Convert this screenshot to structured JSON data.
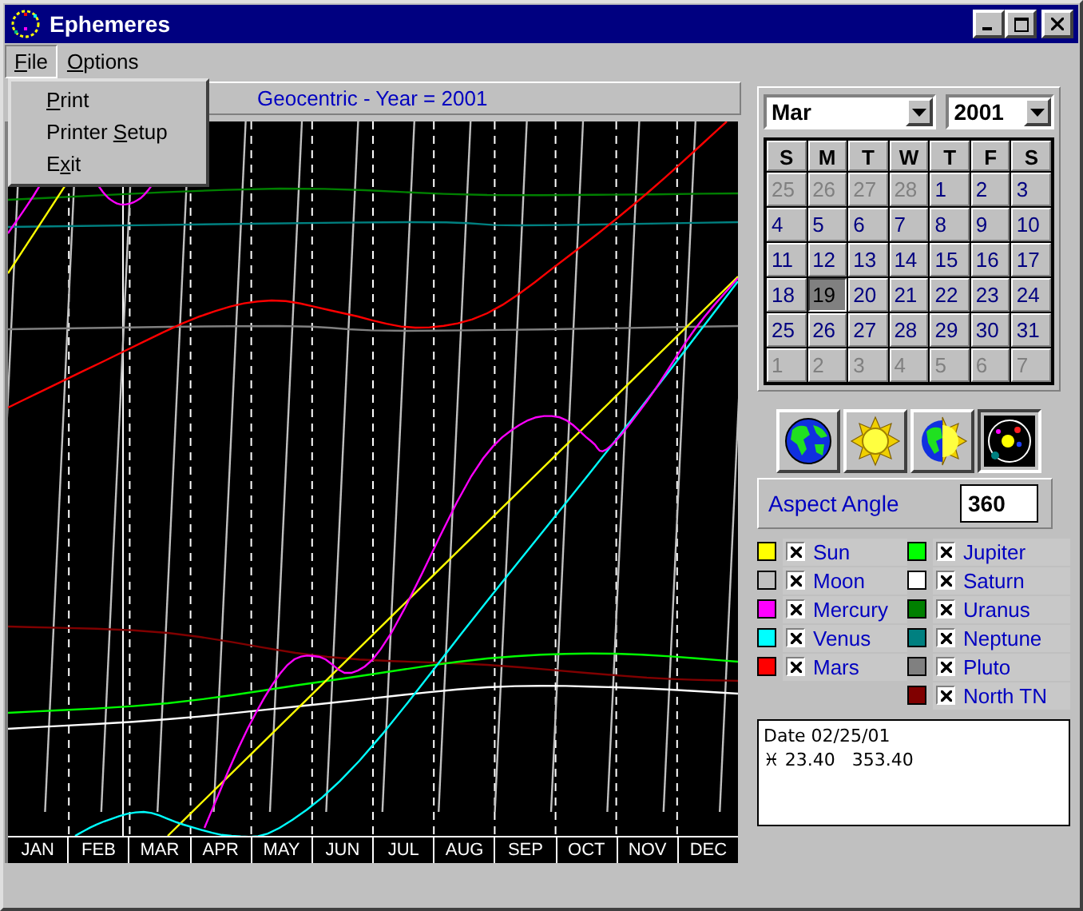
{
  "window": {
    "title": "Ephemeres"
  },
  "menu": [
    {
      "key": "F",
      "post": "ile",
      "open": true
    },
    {
      "key": "O",
      "post": "ptions",
      "open": false
    }
  ],
  "file_menu": [
    {
      "key": "P",
      "post": "rint"
    },
    {
      "pre": "Printer ",
      "key": "S",
      "post": "etup"
    },
    {
      "pre": "E",
      "key": "x",
      "post": "it"
    }
  ],
  "chart_header": "Geocentric - Year = 2001",
  "months": [
    "JAN",
    "FEB",
    "MAR",
    "APR",
    "MAY",
    "JUN",
    "JUL",
    "AUG",
    "SEP",
    "OCT",
    "NOV",
    "DEC"
  ],
  "calendar": {
    "month": "Mar",
    "year": "2001",
    "weekdays": [
      "S",
      "M",
      "T",
      "W",
      "T",
      "F",
      "S"
    ],
    "days": [
      {
        "day": "25",
        "current": false,
        "selected": false
      },
      {
        "day": "26",
        "current": false,
        "selected": false
      },
      {
        "day": "27",
        "current": false,
        "selected": false
      },
      {
        "day": "28",
        "current": false,
        "selected": false
      },
      {
        "day": "1",
        "current": true,
        "selected": false
      },
      {
        "day": "2",
        "current": true,
        "selected": false
      },
      {
        "day": "3",
        "current": true,
        "selected": false
      },
      {
        "day": "4",
        "current": true,
        "selected": false
      },
      {
        "day": "5",
        "current": true,
        "selected": false
      },
      {
        "day": "6",
        "current": true,
        "selected": false
      },
      {
        "day": "7",
        "current": true,
        "selected": false
      },
      {
        "day": "8",
        "current": true,
        "selected": false
      },
      {
        "day": "9",
        "current": true,
        "selected": false
      },
      {
        "day": "10",
        "current": true,
        "selected": false
      },
      {
        "day": "11",
        "current": true,
        "selected": false
      },
      {
        "day": "12",
        "current": true,
        "selected": false
      },
      {
        "day": "13",
        "current": true,
        "selected": false
      },
      {
        "day": "14",
        "current": true,
        "selected": false
      },
      {
        "day": "15",
        "current": true,
        "selected": false
      },
      {
        "day": "16",
        "current": true,
        "selected": false
      },
      {
        "day": "17",
        "current": true,
        "selected": false
      },
      {
        "day": "18",
        "current": true,
        "selected": false
      },
      {
        "day": "19",
        "current": true,
        "selected": true
      },
      {
        "day": "20",
        "current": true,
        "selected": false
      },
      {
        "day": "21",
        "current": true,
        "selected": false
      },
      {
        "day": "22",
        "current": true,
        "selected": false
      },
      {
        "day": "23",
        "current": true,
        "selected": false
      },
      {
        "day": "24",
        "current": true,
        "selected": false
      },
      {
        "day": "25",
        "current": true,
        "selected": false
      },
      {
        "day": "26",
        "current": true,
        "selected": false
      },
      {
        "day": "27",
        "current": true,
        "selected": false
      },
      {
        "day": "28",
        "current": true,
        "selected": false
      },
      {
        "day": "29",
        "current": true,
        "selected": false
      },
      {
        "day": "30",
        "current": true,
        "selected": false
      },
      {
        "day": "31",
        "current": true,
        "selected": false
      },
      {
        "day": "1",
        "current": false,
        "selected": false
      },
      {
        "day": "2",
        "current": false,
        "selected": false
      },
      {
        "day": "3",
        "current": false,
        "selected": false
      },
      {
        "day": "4",
        "current": false,
        "selected": false
      },
      {
        "day": "5",
        "current": false,
        "selected": false
      },
      {
        "day": "6",
        "current": false,
        "selected": false
      },
      {
        "day": "7",
        "current": false,
        "selected": false
      }
    ]
  },
  "view_buttons": [
    {
      "kind": "earth",
      "selected": false
    },
    {
      "kind": "sun",
      "selected": false
    },
    {
      "kind": "both",
      "selected": false
    },
    {
      "kind": "orbits",
      "selected": true
    }
  ],
  "aspect": {
    "label": "Aspect Angle",
    "value": "360"
  },
  "planets": [
    {
      "name": "Sun",
      "color": "#ffff00",
      "checked": true
    },
    {
      "name": "Moon",
      "color": "#c0c0c0",
      "checked": true
    },
    {
      "name": "Mercury",
      "color": "#ff00ff",
      "checked": true
    },
    {
      "name": "Venus",
      "color": "#00ffff",
      "checked": true
    },
    {
      "name": "Mars",
      "color": "#ff0000",
      "checked": true
    },
    {
      "name": "Jupiter",
      "color": "#00ff00",
      "checked": true
    },
    {
      "name": "Saturn",
      "color": "#ffffff",
      "checked": true
    },
    {
      "name": "Uranus",
      "color": "#008000",
      "checked": true
    },
    {
      "name": "Neptune",
      "color": "#008080",
      "checked": true
    },
    {
      "name": "Pluto",
      "color": "#808080",
      "checked": true
    },
    {
      "name": "North TN",
      "color": "#800000",
      "checked": true
    }
  ],
  "info": [
    "Date 02/25/01",
    "♓ 23.40   353.40"
  ]
}
